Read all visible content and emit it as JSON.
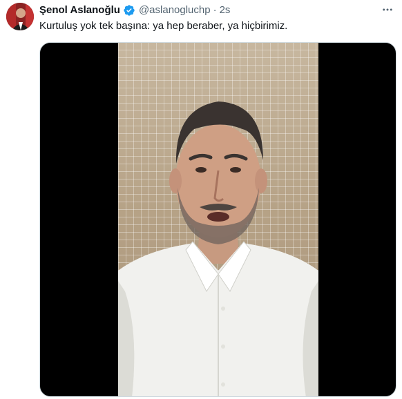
{
  "tweet": {
    "author_name": "Şenol Aslanoğlu",
    "handle": "@aslanogluchp",
    "separator": "·",
    "time": "2s",
    "text": "Kurtuluş yok tek başına: ya hep beraber, ya hiçbirimiz."
  },
  "icons": {
    "verified": "verified-badge-icon",
    "more": "more-options-icon"
  },
  "colors": {
    "verified_blue": "#1d9bf0",
    "secondary_text": "#536471",
    "primary_text": "#0f1419"
  }
}
